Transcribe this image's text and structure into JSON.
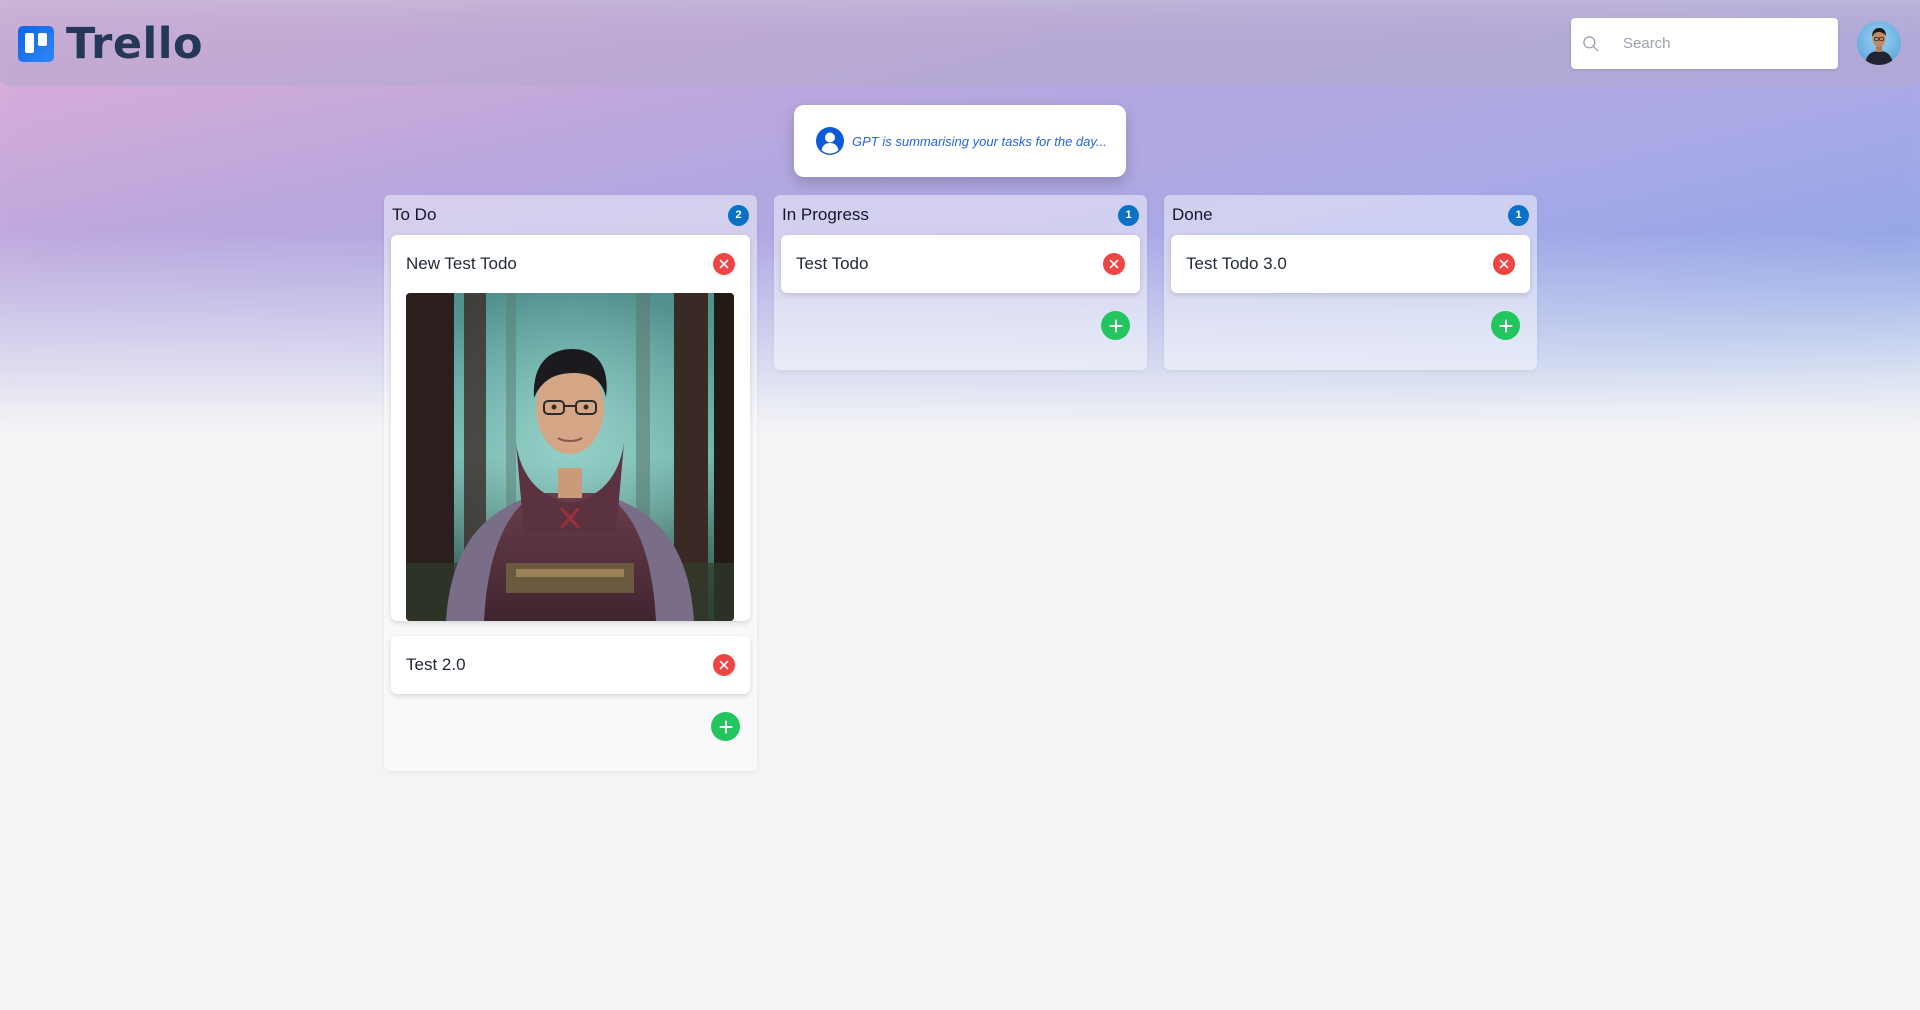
{
  "app": {
    "name": "Trello"
  },
  "header": {
    "search_placeholder": "Search",
    "avatar_icon": "user-avatar"
  },
  "summary": {
    "text": "GPT is summarising your tasks for the day..."
  },
  "columns": [
    {
      "title": "To Do",
      "count": "2",
      "cards": [
        {
          "title": "New Test Todo",
          "has_image": true,
          "image_subject": "character-portrait"
        },
        {
          "title": "Test 2.0",
          "has_image": false
        }
      ]
    },
    {
      "title": "In Progress",
      "count": "1",
      "cards": [
        {
          "title": "Test Todo",
          "has_image": false
        }
      ]
    },
    {
      "title": "Done",
      "count": "1",
      "cards": [
        {
          "title": "Test Todo 3.0",
          "has_image": false
        }
      ]
    }
  ],
  "colors": {
    "badge": "#0a72c6",
    "remove": "#ef4444",
    "add": "#22c55e",
    "summary_text": "#2563eb",
    "logo_text": "#253858"
  }
}
